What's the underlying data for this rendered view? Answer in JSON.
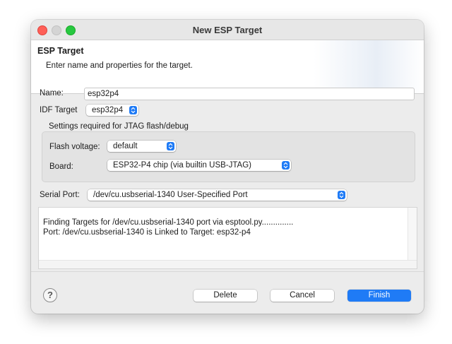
{
  "window": {
    "title": "New ESP Target"
  },
  "banner": {
    "title": "ESP Target",
    "description": "Enter name and properties for the target."
  },
  "form": {
    "name_label": "Name:",
    "name_value": "esp32p4",
    "idf_target_label": "IDF Target",
    "idf_target_value": "esp32p4",
    "jtag_group_title": "Settings required for JTAG flash/debug",
    "flash_voltage_label": "Flash voltage:",
    "flash_voltage_value": "default",
    "board_label": "Board:",
    "board_value": "ESP32-P4 chip (via builtin USB-JTAG)",
    "serial_port_label": "Serial Port:",
    "serial_port_value": "/dev/cu.usbserial-1340 User-Specified Port"
  },
  "console": {
    "lines": [
      "Finding Targets for /dev/cu.usbserial-1340 port via esptool.py..............",
      "Port: /dev/cu.usbserial-1340 is Linked to Target: esp32-p4"
    ]
  },
  "footer": {
    "help_glyph": "?",
    "delete_label": "Delete",
    "cancel_label": "Cancel",
    "finish_label": "Finish"
  },
  "colors": {
    "accent": "#1f7bf6",
    "close": "#fe5f57",
    "maximize": "#27c840"
  }
}
